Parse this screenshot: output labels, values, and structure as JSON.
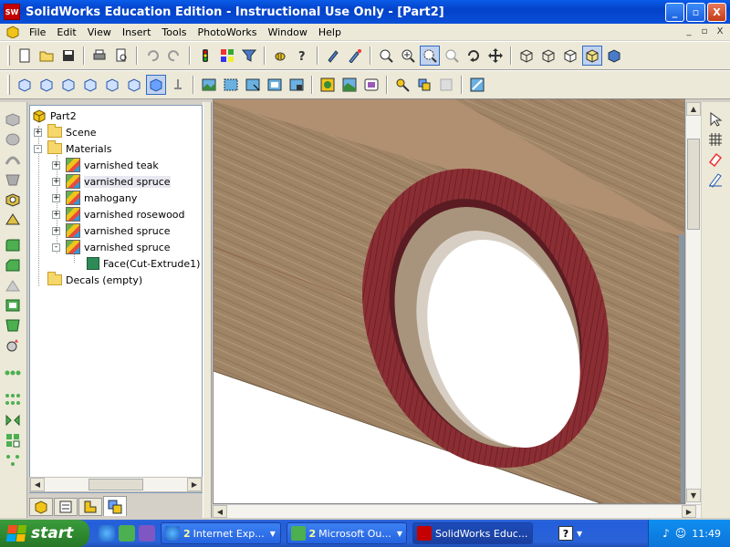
{
  "window": {
    "title": "SolidWorks Education Edition - Instructional Use Only - [Part2]",
    "logo_text": "SW",
    "buttons": [
      "_",
      "▫",
      "X"
    ]
  },
  "menubar": {
    "items": [
      "File",
      "Edit",
      "View",
      "Insert",
      "Tools",
      "PhotoWorks",
      "Window",
      "Help"
    ],
    "mdi_buttons": [
      "_",
      "▫",
      "X"
    ]
  },
  "toolbar1": {
    "icons": [
      "new-document-icon",
      "open-folder-icon",
      "save-icon",
      "print-icon",
      "print-preview-icon",
      "undo-icon",
      "redo-icon",
      "traffic-light-icon",
      "options-grid-icon",
      "select-filter-icon",
      "bee-icon",
      "help-icon",
      "pencil-icon",
      "edit-sketch-icon",
      "zoom-fit-icon",
      "zoom-in-icon",
      "zoom-area-icon",
      "zoom-out-icon",
      "rotate-icon",
      "pan-icon",
      "wireframe-icon",
      "hidden-lines-visible-icon",
      "hidden-lines-removed-icon",
      "shaded-with-edges-icon",
      "shaded-icon"
    ]
  },
  "toolbar2": {
    "icons": [
      "front-view-icon",
      "back-view-icon",
      "left-view-icon",
      "right-view-icon",
      "top-view-icon",
      "bottom-view-icon",
      "isometric-view-icon",
      "normal-to-icon",
      "render-icon",
      "render-area-icon",
      "render-selected-icon",
      "render-last-icon",
      "render-to-file-icon",
      "material-icon",
      "scene-icon",
      "decal-icon",
      "lighting-icon",
      "options-icon",
      "disabled-icon",
      "photoworks-options-icon"
    ]
  },
  "tree": {
    "root": "Part2",
    "items": [
      {
        "label": "Scene",
        "level": 1,
        "type": "folder",
        "expander": "+"
      },
      {
        "label": "Materials",
        "level": 1,
        "type": "folder",
        "expander": "-"
      },
      {
        "label": "varnished teak",
        "level": 2,
        "type": "material",
        "expander": "+"
      },
      {
        "label": "varnished spruce",
        "level": 2,
        "type": "material",
        "expander": "+",
        "selected": true
      },
      {
        "label": "mahogany",
        "level": 2,
        "type": "material",
        "expander": "+"
      },
      {
        "label": "varnished rosewood",
        "level": 2,
        "type": "material",
        "expander": "+"
      },
      {
        "label": "varnished spruce",
        "level": 2,
        "type": "material",
        "expander": "+"
      },
      {
        "label": "varnished spruce",
        "level": 2,
        "type": "material",
        "expander": "-"
      },
      {
        "label": "Face(Cut-Extrude1) :",
        "level": 3,
        "type": "face",
        "expander": ""
      },
      {
        "label": "Decals (empty)",
        "level": 1,
        "type": "folder",
        "expander": ""
      }
    ]
  },
  "panel_tabs": [
    "feature-manager-tab",
    "property-manager-tab",
    "configuration-manager-tab",
    "photoworks-tab"
  ],
  "taskbar": {
    "start_label": "start",
    "tasks": [
      {
        "count": "2",
        "label": "Internet Exp...",
        "icon": "ie-icon"
      },
      {
        "count": "2",
        "label": "Microsoft Ou...",
        "icon": "outlook-icon"
      },
      {
        "count": "",
        "label": "SolidWorks Educ...",
        "icon": "solidworks-icon",
        "active": true
      }
    ],
    "clock": "11:49"
  },
  "colors": {
    "wood_plank": "#a08466",
    "rosewood_ring": "#8b2e34",
    "inner_bore": "#b8a48c",
    "xp_blue": "#245edb"
  }
}
